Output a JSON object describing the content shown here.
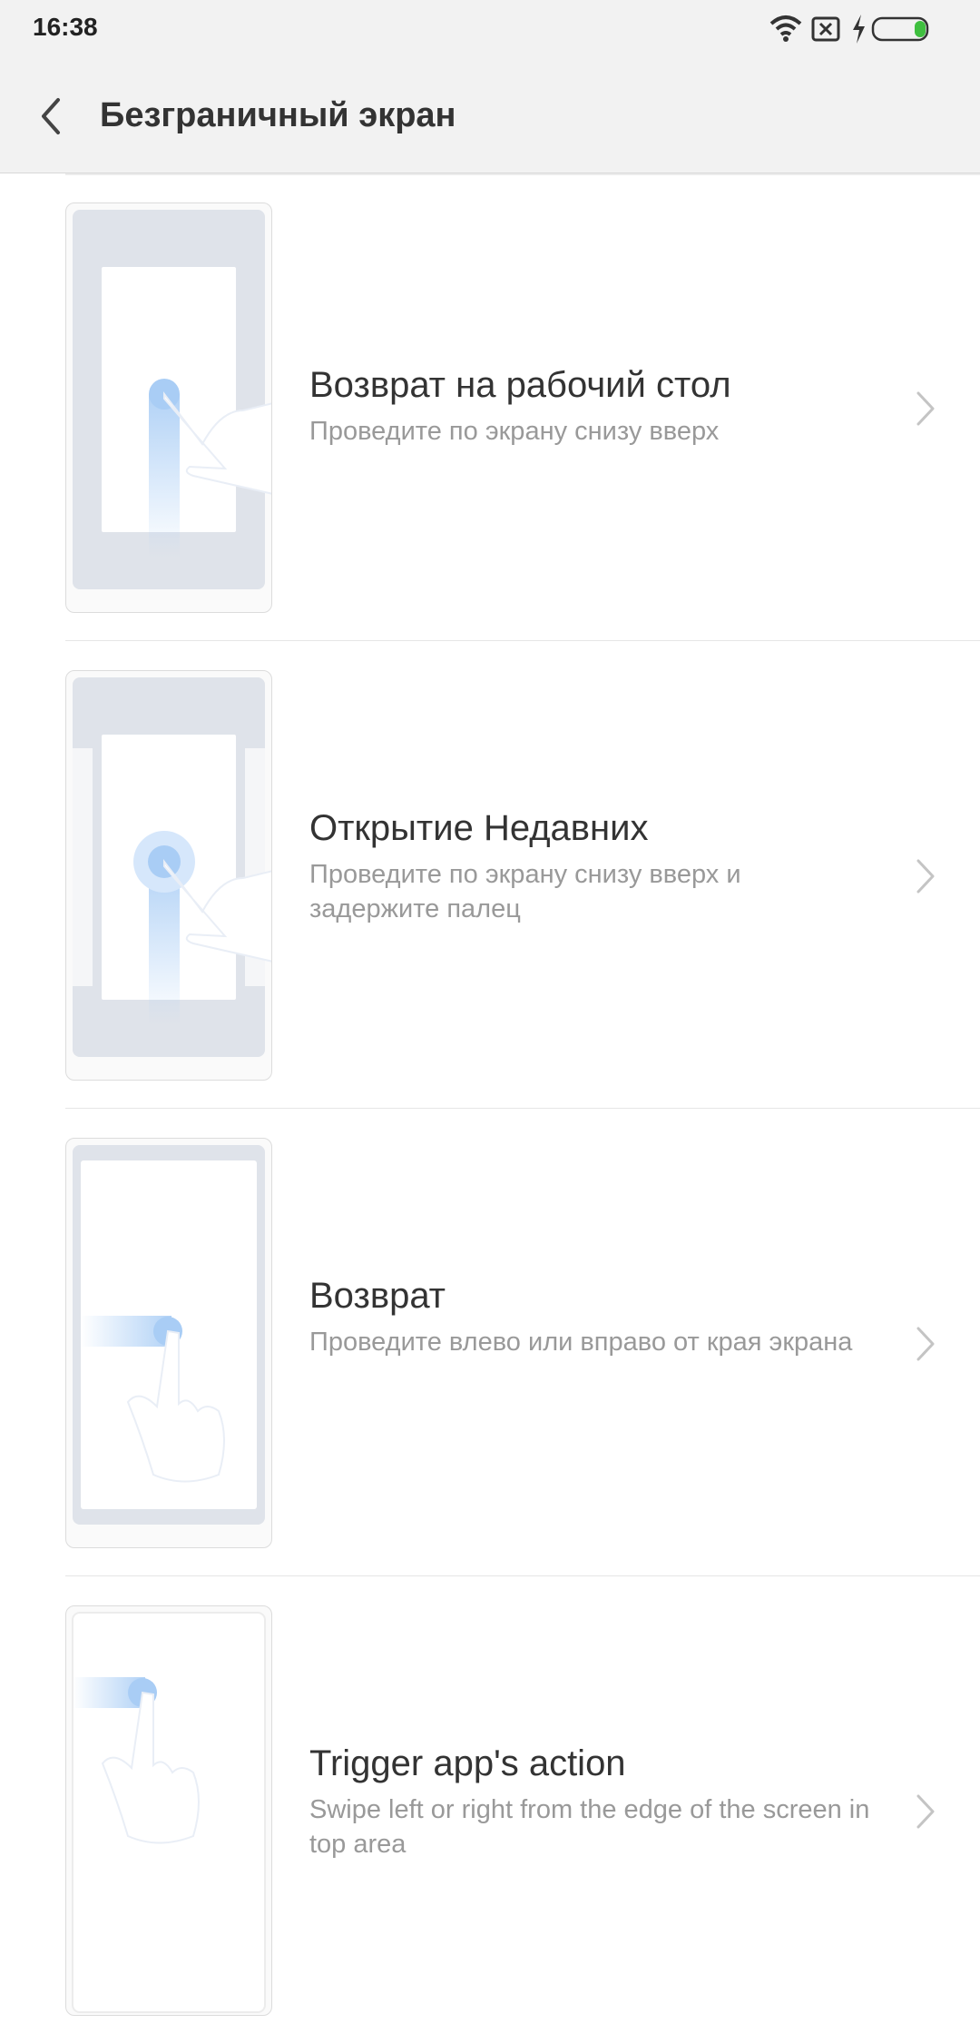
{
  "status_bar": {
    "time": "16:38",
    "icons": [
      "wifi-icon",
      "sim-disabled-icon",
      "charging-icon",
      "battery-icon"
    ],
    "battery_color": "#3fbf3f"
  },
  "app_bar": {
    "title": "Безграничный экран",
    "back_icon": "chevron-left-icon"
  },
  "items": [
    {
      "title": "Возврат на рабочий стол",
      "subtitle": "Проведите по экрану снизу вверх"
    },
    {
      "title": "Открытие Недавних",
      "subtitle": "Проведите по экрану снизу вверх и задержите палец"
    },
    {
      "title": "Возврат",
      "subtitle": "Проведите влево или вправо от края экрана"
    },
    {
      "title": "Trigger app's action",
      "subtitle": "Swipe left or right from the edge of the screen in top area"
    }
  ],
  "colors": {
    "background": "#ffffff",
    "bar": "#f2f2f2",
    "accent_blue": "#a9cdf5"
  }
}
